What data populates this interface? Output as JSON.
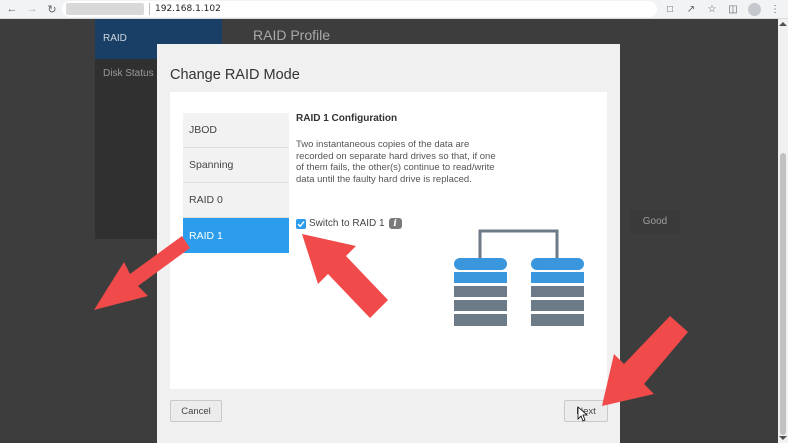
{
  "browser": {
    "url": "192.168.1.102"
  },
  "background_app": {
    "nav_active": "RAID",
    "nav_item_2": "Disk Status",
    "page_title": "RAID Profile",
    "status_cell": "Good"
  },
  "modal": {
    "title": "Change RAID Mode",
    "modes": [
      {
        "label": "JBOD",
        "selected": false
      },
      {
        "label": "Spanning",
        "selected": false
      },
      {
        "label": "RAID 0",
        "selected": false
      },
      {
        "label": "RAID 1",
        "selected": true
      }
    ],
    "config_title": "RAID 1 Configuration",
    "config_description": "Two instantaneous copies of the data are recorded on separate hard drives so that, if one of them fails, the other(s) continue to read/write data until the faulty hard drive is replaced.",
    "switch_label": "Switch to RAID 1",
    "switch_checked": true,
    "cancel_label": "Cancel",
    "next_label": "Next"
  },
  "colors": {
    "accent": "#2b9dec",
    "diagram_blue": "#3b97dd",
    "diagram_gray": "#6d7a87",
    "arrow": "#f04a4a"
  }
}
